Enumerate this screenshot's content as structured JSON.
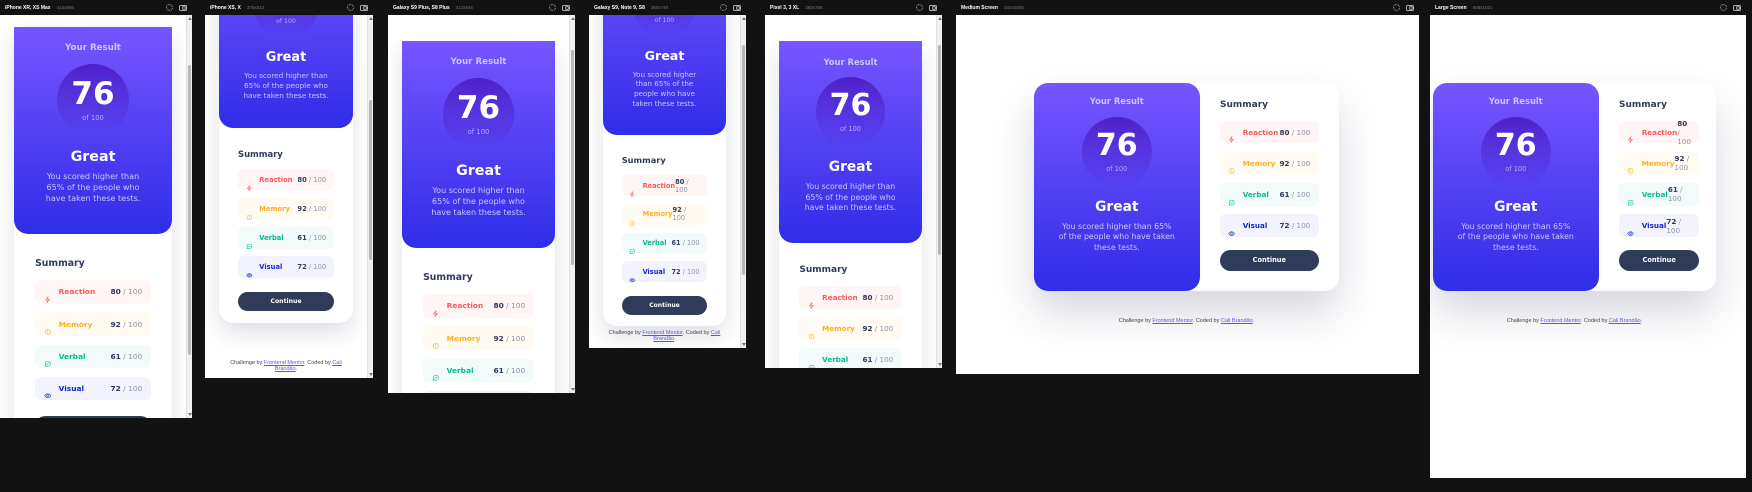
{
  "devices": [
    {
      "name": "iPhone XR, XS Max",
      "size": "414x896"
    },
    {
      "name": "iPhone XS, X",
      "size": "375x812"
    },
    {
      "name": "Galaxy S9 Plus, S8 Plus",
      "size": "412x846"
    },
    {
      "name": "Galaxy S9, Note 9, S8",
      "size": "360x740"
    },
    {
      "name": "Pixel 3, 3 XL",
      "size": "393x786"
    },
    {
      "name": "Medium Screen",
      "size": "1024x800"
    },
    {
      "name": "Large Screen",
      "size": "668x1021"
    }
  ],
  "result": {
    "label": "Your Result",
    "score": "76",
    "score_of": "of 100",
    "grade": "Great",
    "description": "You scored higher than 65% of the people who have taken these tests."
  },
  "summary": {
    "title": "Summary",
    "items": [
      {
        "name": "Reaction",
        "score": "80",
        "total": " / 100",
        "icon": "lightning-icon",
        "color": "#ff5757",
        "bg": "#fff5f4"
      },
      {
        "name": "Memory",
        "score": "92",
        "total": " / 100",
        "icon": "brain-icon",
        "color": "#ffb01f",
        "bg": "#fffbf3"
      },
      {
        "name": "Verbal",
        "score": "61",
        "total": " / 100",
        "icon": "speech-bubble-icon",
        "color": "#00bb8f",
        "bg": "#f2fbf9"
      },
      {
        "name": "Visual",
        "score": "72",
        "total": " / 100",
        "icon": "eye-icon",
        "color": "#1125d4",
        "bg": "#f3f3fd"
      }
    ],
    "button": "Continue"
  },
  "attribution": {
    "prefix": "Challenge by ",
    "fm": "Frontend Mentor",
    "mid": ". Coded by ",
    "author": "Cali Brandão",
    "suffix": "."
  },
  "colors": {
    "gradient_top": "#7755ff",
    "gradient_bottom": "#2f2de8",
    "dark_navy": "#303b59",
    "frame_background": "#121212"
  }
}
